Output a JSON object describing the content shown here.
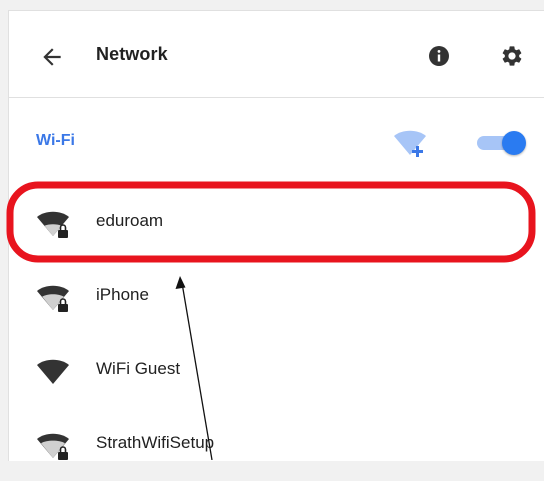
{
  "header": {
    "title": "Network",
    "back_icon": "arrow-back-icon",
    "info_icon": "info-icon",
    "settings_icon": "gear-icon"
  },
  "wifi": {
    "label": "Wi-Fi",
    "add_icon": "wifi-add-icon",
    "enabled": true
  },
  "networks": [
    {
      "name": "eduroam",
      "secured": true,
      "icon": "wifi-lock-icon"
    },
    {
      "name": "iPhone",
      "secured": true,
      "icon": "wifi-lock-icon"
    },
    {
      "name": "WiFi Guest",
      "secured": false,
      "icon": "wifi-icon"
    },
    {
      "name": "StrathWifiSetup",
      "secured": true,
      "icon": "wifi-lock-icon"
    }
  ],
  "colors": {
    "accent": "#3b78e7",
    "highlight": "#e8141e",
    "toggle_on": "#2a7bf1"
  }
}
